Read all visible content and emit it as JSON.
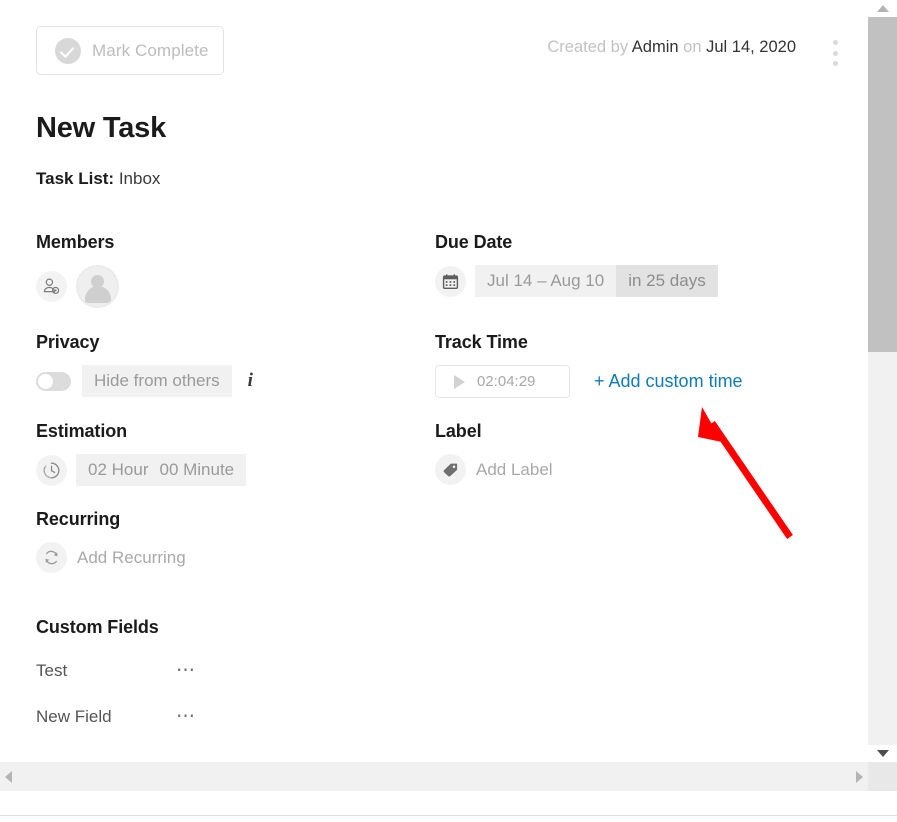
{
  "header": {
    "mark_complete_label": "Mark Complete",
    "created_prefix": "Created by",
    "created_by": "Admin",
    "created_on_word": "on",
    "created_date": "Jul 14, 2020",
    "kebab_icon": "more-vertical-icon"
  },
  "task": {
    "title": "New Task",
    "task_list_key": "Task List:",
    "task_list_value": "Inbox"
  },
  "members": {
    "heading": "Members",
    "add_member_icon": "add-member-icon",
    "avatar_icon": "user-avatar-icon"
  },
  "privacy": {
    "heading": "Privacy",
    "toggle_state": "off",
    "value": "Hide from others",
    "info_icon": "info-icon"
  },
  "estimation": {
    "heading": "Estimation",
    "clock_icon": "clock-icon",
    "hours": "02 Hour",
    "minutes": "00 Minute"
  },
  "recurring": {
    "heading": "Recurring",
    "refresh_icon": "refresh-icon",
    "placeholder": "Add Recurring"
  },
  "custom_fields": {
    "heading": "Custom Fields",
    "rows": [
      {
        "name": "Test",
        "menu_icon": "ellipsis-icon"
      },
      {
        "name": "New Field",
        "menu_icon": "ellipsis-icon"
      }
    ]
  },
  "due_date": {
    "heading": "Due Date",
    "calendar_icon": "calendar-icon",
    "range": "Jul 14  –  Aug 10",
    "relative": "in 25 days"
  },
  "track_time": {
    "heading": "Track Time",
    "play_icon": "play-icon",
    "timer": "02:04:29",
    "add_custom_time": "+ Add custom time"
  },
  "label": {
    "heading": "Label",
    "tag_icon": "tag-icon",
    "placeholder": "Add Label"
  },
  "scrollbars": {
    "v_up_icon": "caret-up-icon",
    "v_down_icon": "caret-down-icon",
    "h_left_icon": "caret-left-icon",
    "h_right_icon": "caret-right-icon"
  },
  "annotation": {
    "arrow_icon": "red-arrow-icon",
    "color": "#fe0000"
  },
  "colors": {
    "link": "#0f7cb5",
    "heading": "#1b1b1b",
    "muted": "#a9a9a9",
    "pill_bg": "#f1f1f1",
    "pill_bg_dark": "#e2e2e2"
  }
}
